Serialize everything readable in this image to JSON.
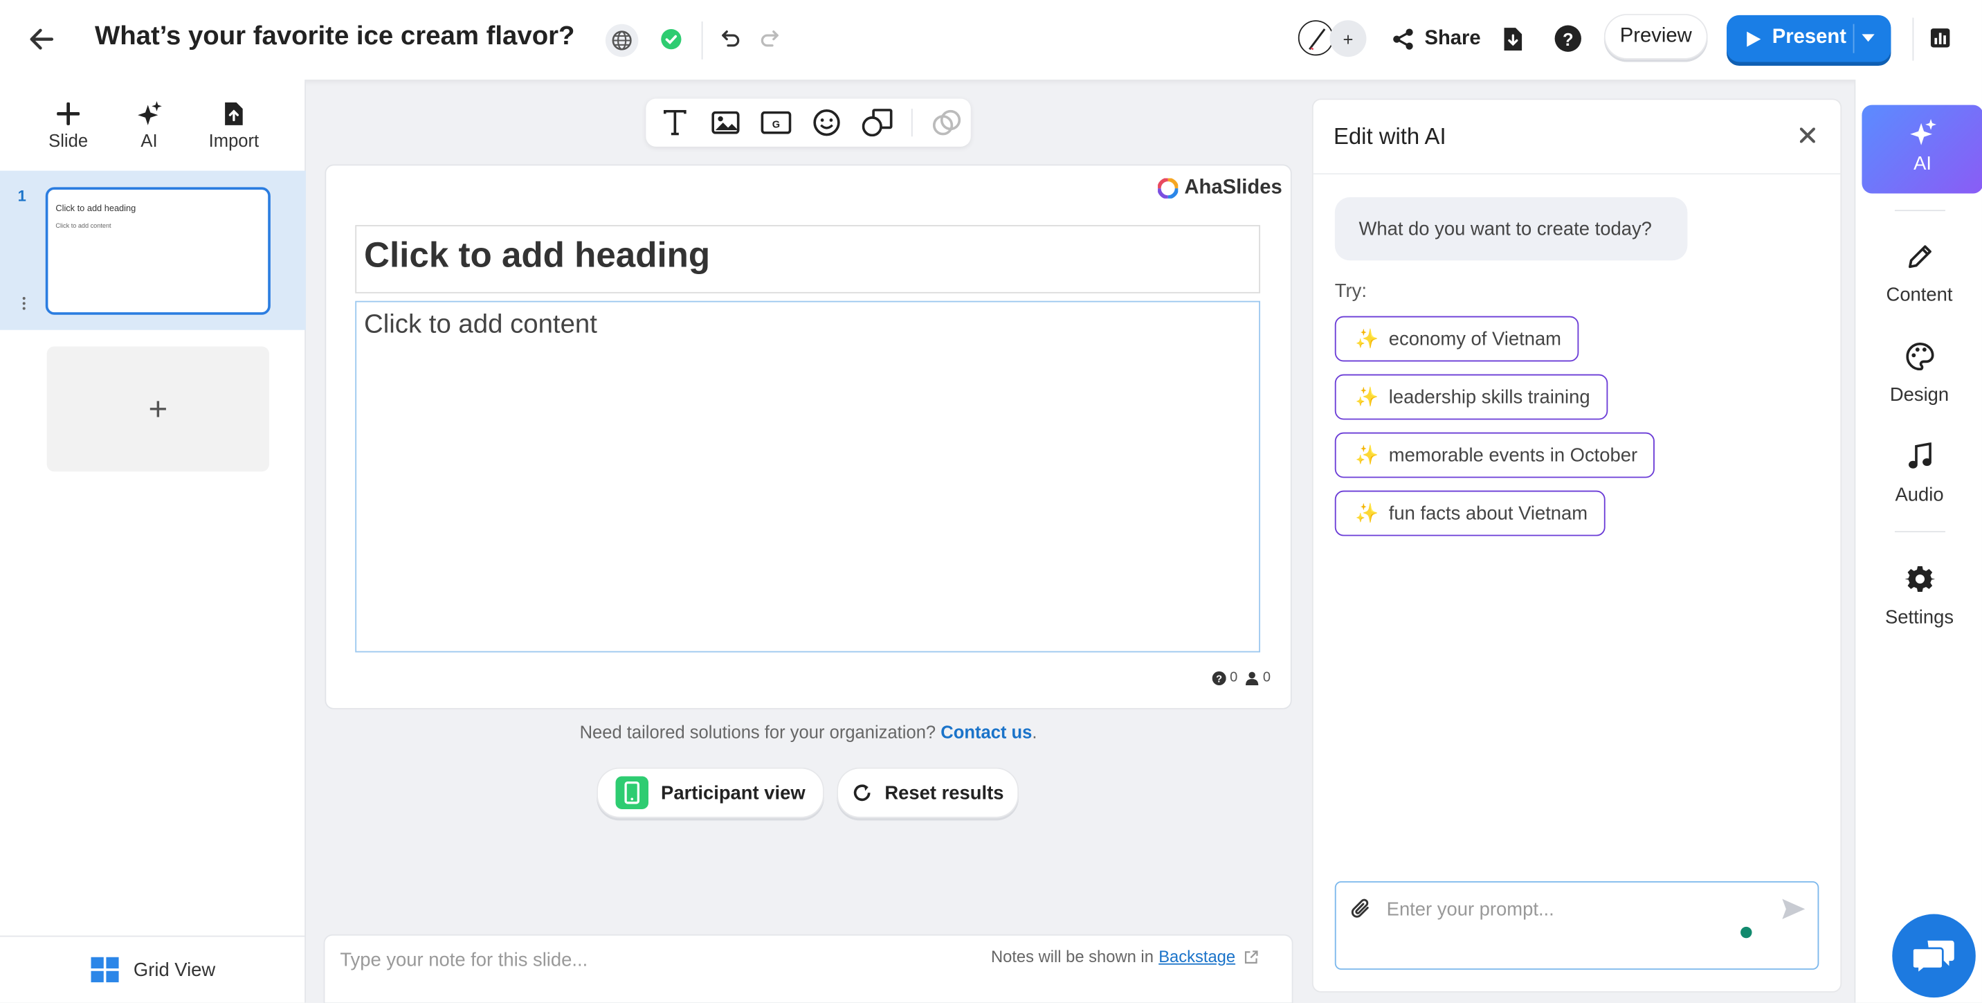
{
  "header": {
    "title": "What’s your favorite ice cream flavor?",
    "avatar_add": "+",
    "share_label": "Share",
    "preview_label": "Preview",
    "present_label": "Present"
  },
  "left_panel": {
    "tools": [
      {
        "label": "Slide",
        "icon": "plus-icon"
      },
      {
        "label": "AI",
        "icon": "sparkles-icon"
      },
      {
        "label": "Import",
        "icon": "import-file-icon"
      }
    ],
    "slides": [
      {
        "number": "1",
        "heading": "Click to add heading",
        "content": "Click to add content"
      }
    ],
    "add_slide": "+",
    "grid_view_label": "Grid View"
  },
  "editor": {
    "brand": "AhaSlides",
    "heading_placeholder": "Click to add heading",
    "content_placeholder": "Click to add content",
    "question_count": "0",
    "participant_count": "0",
    "footer_text": "Need tailored solutions for your organization?",
    "footer_link": "Contact us",
    "footer_suffix": ".",
    "participant_view_label": "Participant view",
    "reset_results_label": "Reset results",
    "notes_placeholder": "Type your note for this slide...",
    "notes_info": "Notes will be shown in",
    "notes_link": "Backstage"
  },
  "ai_panel": {
    "title": "Edit with AI",
    "bubble": "What do you want to create today?",
    "try_label": "Try:",
    "suggestions": [
      {
        "emoji": "✨",
        "text": "economy of Vietnam"
      },
      {
        "emoji": "✨",
        "text": "leadership skills training"
      },
      {
        "emoji": "✨",
        "text": "memorable events in October"
      },
      {
        "emoji": "✨",
        "text": "fun facts about Vietnam"
      }
    ],
    "prompt_placeholder": "Enter your prompt..."
  },
  "right_rail": {
    "items": [
      {
        "label": "AI",
        "icon": "sparkles-icon"
      },
      {
        "label": "Content",
        "icon": "pencil-icon"
      },
      {
        "label": "Design",
        "icon": "palette-icon"
      },
      {
        "label": "Audio",
        "icon": "music-note-icon"
      },
      {
        "label": "Settings",
        "icon": "gear-icon"
      }
    ]
  },
  "colors": {
    "primary": "#1a7ee6",
    "accent_purple": "#6a3bd6",
    "ai_gradient_start": "#5b8cff",
    "ai_gradient_end": "#8a5cf5",
    "success": "#2ecc71",
    "selection_bg": "#dbe9f8"
  }
}
